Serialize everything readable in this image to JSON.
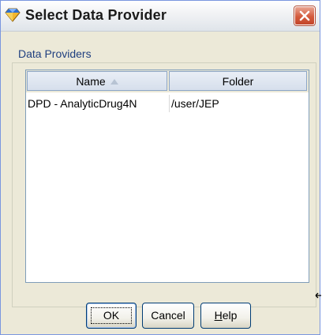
{
  "window": {
    "title": "Select Data Provider",
    "close_label": "X"
  },
  "group": {
    "label": "Data Providers"
  },
  "table": {
    "columns": [
      {
        "label": "Name",
        "sorted": "ascending"
      },
      {
        "label": "Folder"
      }
    ],
    "rows": [
      {
        "name": "DPD - AnalyticDrug4N",
        "folder": "/user/JEP"
      }
    ]
  },
  "buttons": {
    "ok": "OK",
    "cancel": "Cancel",
    "help_mnemonic": "H",
    "help_rest": "elp"
  },
  "icons": {
    "title_icon": "diamond-icon",
    "close_icon": "close-icon",
    "sort_icon": "sort-ascending-icon",
    "cursor_icon": "resize-cursor-icon"
  },
  "colors": {
    "dialog_bg": "#ece9d8",
    "close_red": "#d45a3c",
    "group_label": "#1f3f7f"
  }
}
